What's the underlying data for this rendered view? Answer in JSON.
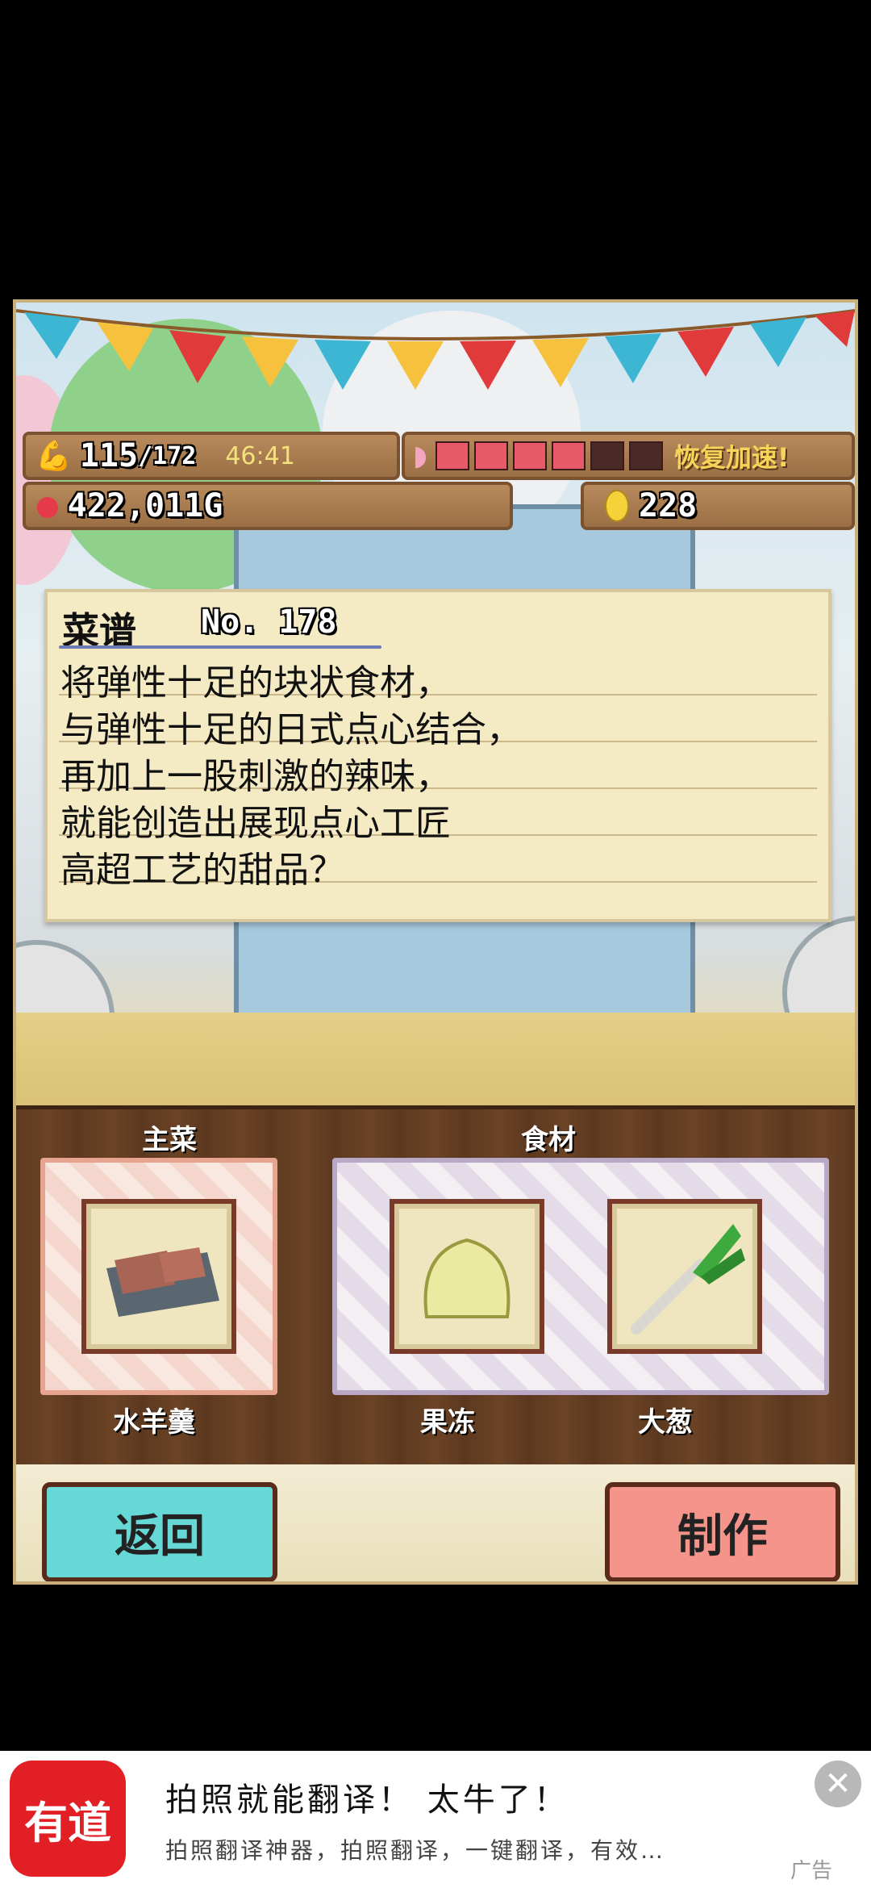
{
  "status": {
    "stamina_current": "115",
    "stamina_max": "/172",
    "timer": "46:41",
    "hunger_filled": 4,
    "hunger_total": 6,
    "recover_label": "恢复加速!",
    "money": "422,011G",
    "eggs": "228"
  },
  "recipe": {
    "title": "菜谱",
    "number": "No. 178",
    "lines": [
      "将弹性十足的块状食材，",
      "与弹性十足的日式点心结合，",
      "再加上一股刺激的辣味，",
      "就能创造出展现点心工匠",
      "高超工艺的甜品？"
    ]
  },
  "slots": {
    "main_header": "主菜",
    "ingredients_header": "食材",
    "main_item": "水羊羹",
    "ingredient_1": "果冻",
    "ingredient_2": "大葱"
  },
  "buttons": {
    "back": "返回",
    "make": "制作"
  },
  "ad": {
    "logo": "有道",
    "title": "拍照就能翻译！ 太牛了！",
    "desc": "拍照翻译神器，拍照翻译，一键翻译，有效…",
    "tag": "广告",
    "close": "✕"
  },
  "colors": {
    "back_button": "#66d8d6",
    "make_button": "#f4948a",
    "hunger_filled": "#e85a6a",
    "hunger_empty": "#4a2a24",
    "timer": "#f3e27a",
    "recover": "#f7d35a"
  }
}
